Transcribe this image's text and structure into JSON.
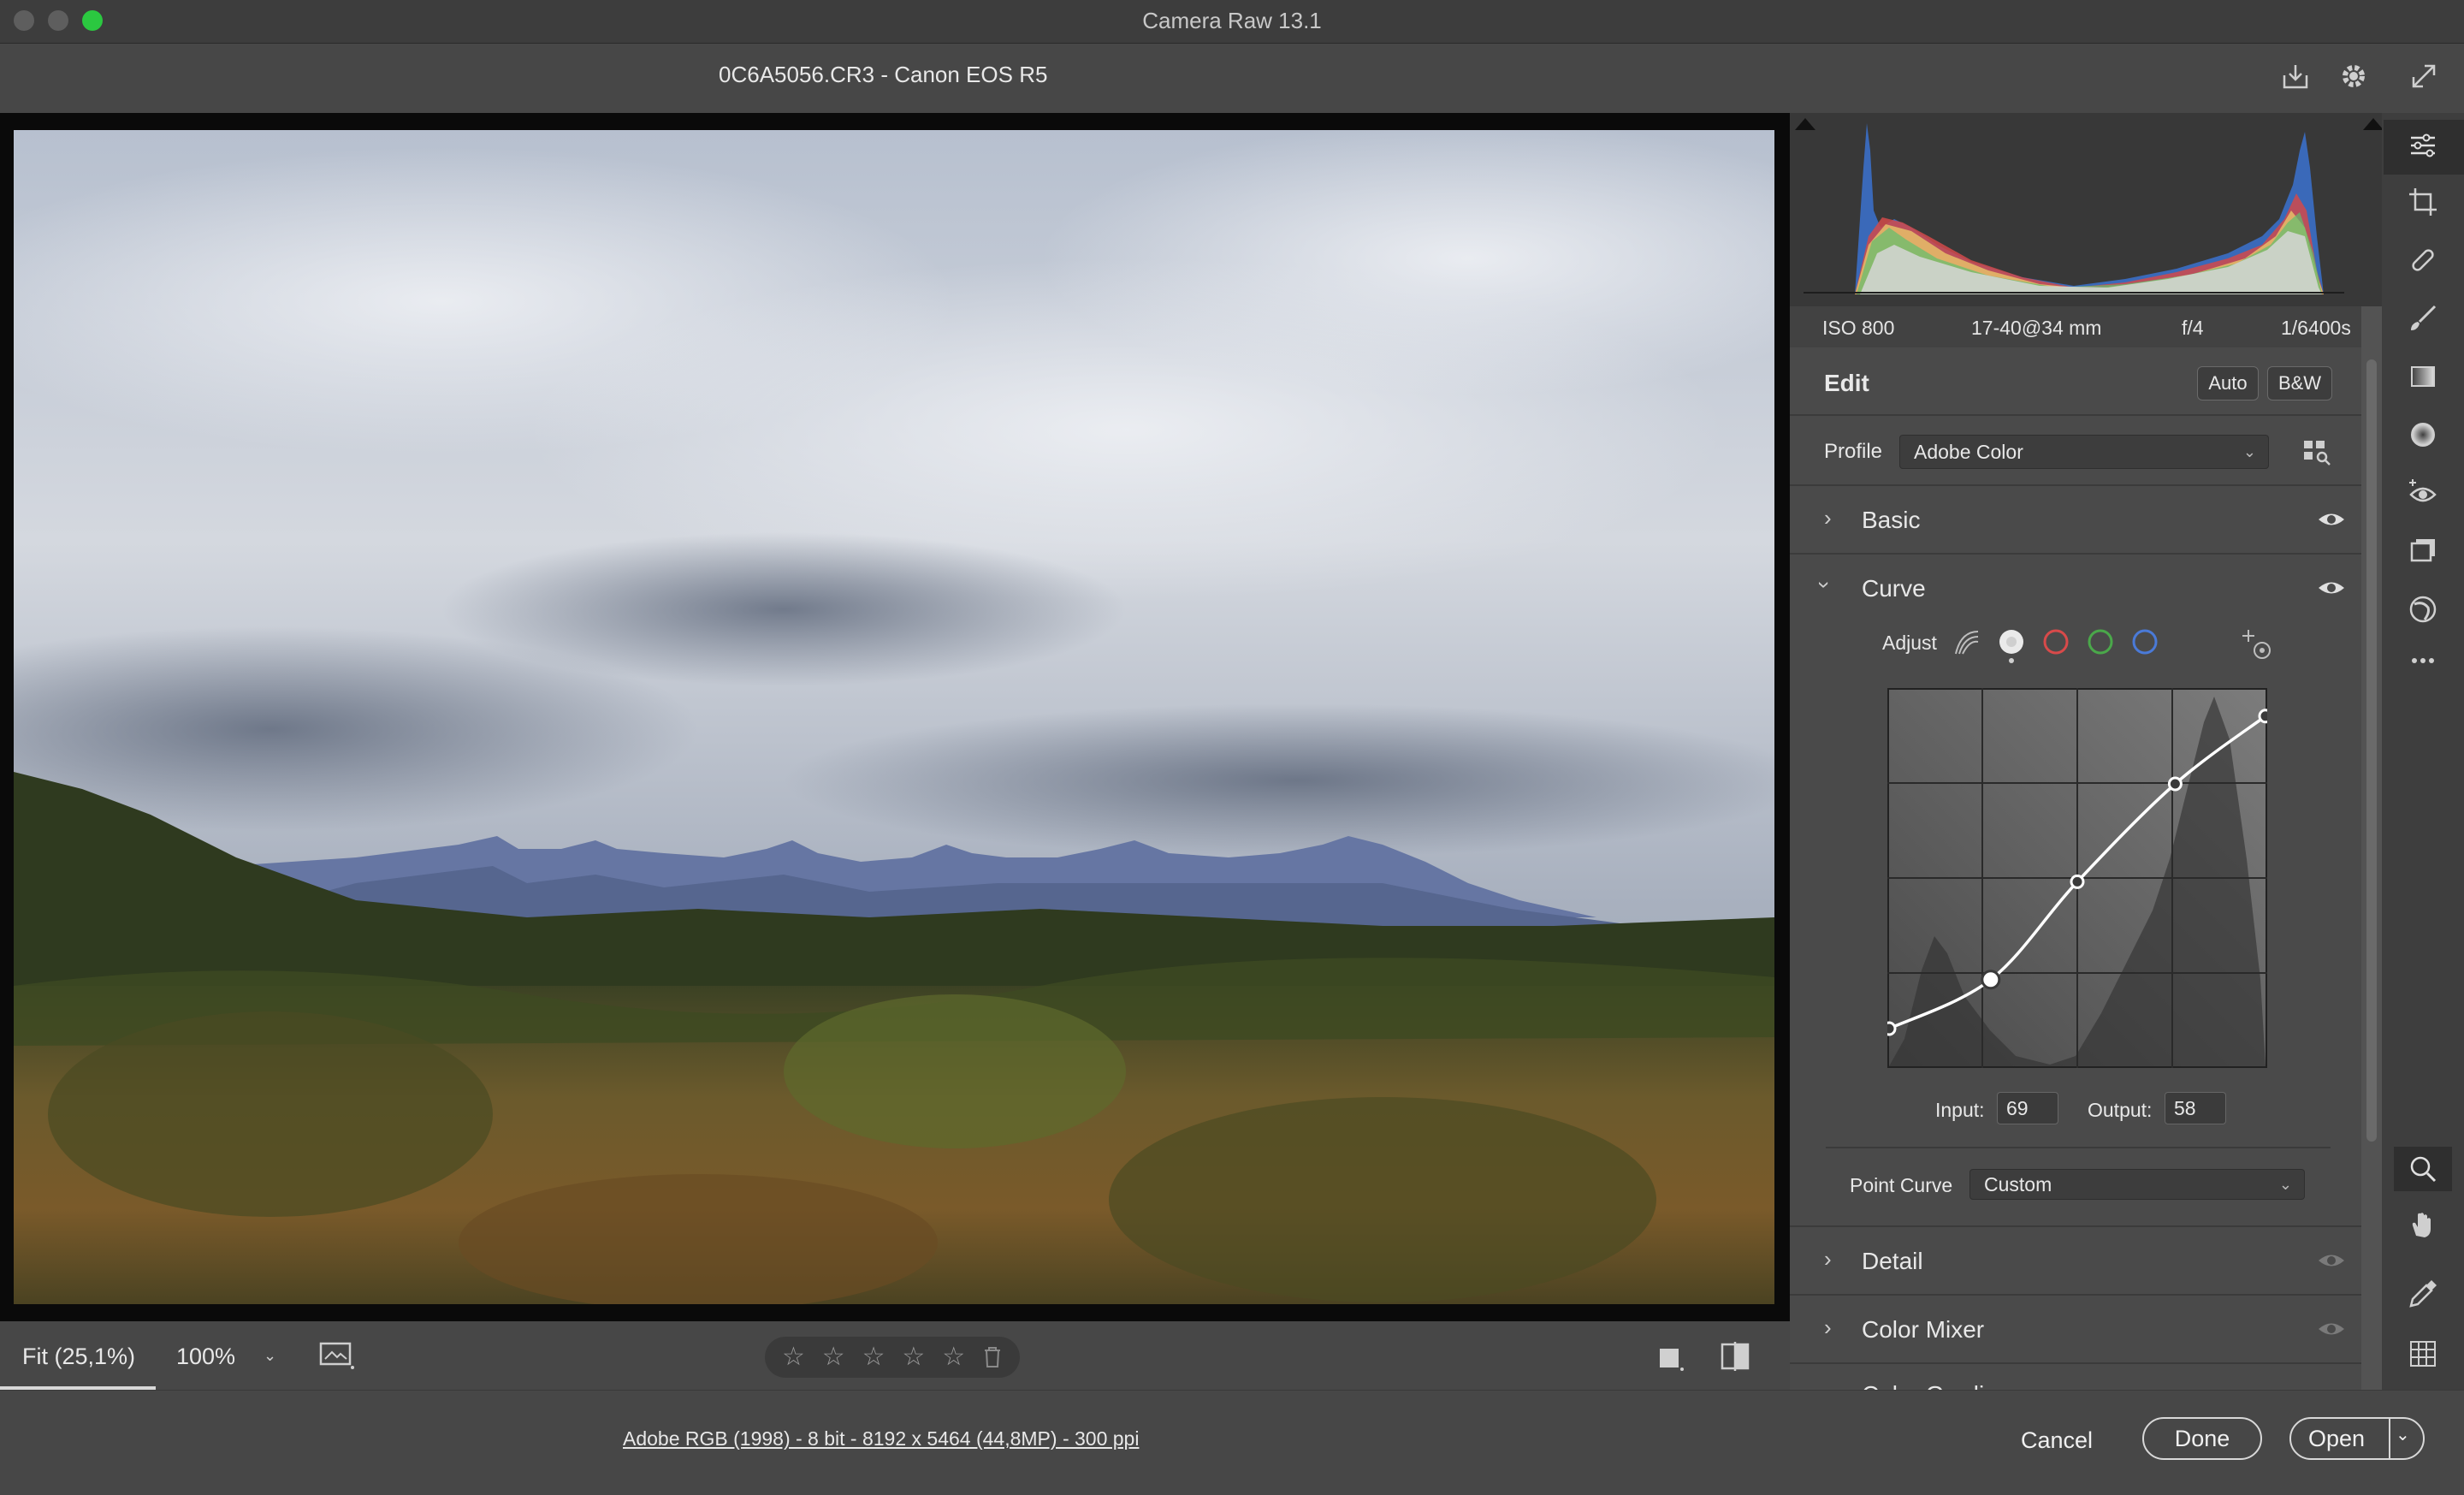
{
  "window": {
    "title": "Camera Raw 13.1"
  },
  "file": {
    "name": "0C6A5056.CR3  -  Canon EOS R5"
  },
  "exif": {
    "iso": "ISO 800",
    "lens": "17-40@34 mm",
    "aperture": "f/4",
    "shutter": "1/6400s"
  },
  "edit": {
    "title": "Edit",
    "auto_label": "Auto",
    "bw_label": "B&W",
    "profile_label": "Profile",
    "profile_value": "Adobe Color"
  },
  "sections": {
    "basic": "Basic",
    "curve": "Curve",
    "detail": "Detail",
    "color_mixer": "Color Mixer",
    "color_grading_partial": "Color Grading"
  },
  "curve": {
    "adjust_label": "Adjust",
    "input_label": "Input:",
    "input_value": "69",
    "output_label": "Output:",
    "output_value": "58",
    "point_curve_label": "Point Curve",
    "point_curve_value": "Custom",
    "points": [
      [
        0,
        0.1
      ],
      [
        0.27,
        0.23
      ],
      [
        0.5,
        0.49
      ],
      [
        0.76,
        0.75
      ],
      [
        1,
        0.93
      ]
    ],
    "selected_point": 1
  },
  "view": {
    "zoom_fit": "Fit (25,1%)",
    "zoom_100": "100%",
    "stars": [
      "☆",
      "☆",
      "☆",
      "☆",
      "☆"
    ]
  },
  "footer": {
    "workflow": "Adobe RGB (1998) - 8 bit - 8192 x 5464 (44,8MP) - 300 ppi",
    "cancel": "Cancel",
    "done": "Done",
    "open": "Open"
  },
  "colors": {
    "accent_red": "#d84a4a",
    "accent_green": "#4aa84a",
    "accent_blue": "#4a7ad8"
  }
}
